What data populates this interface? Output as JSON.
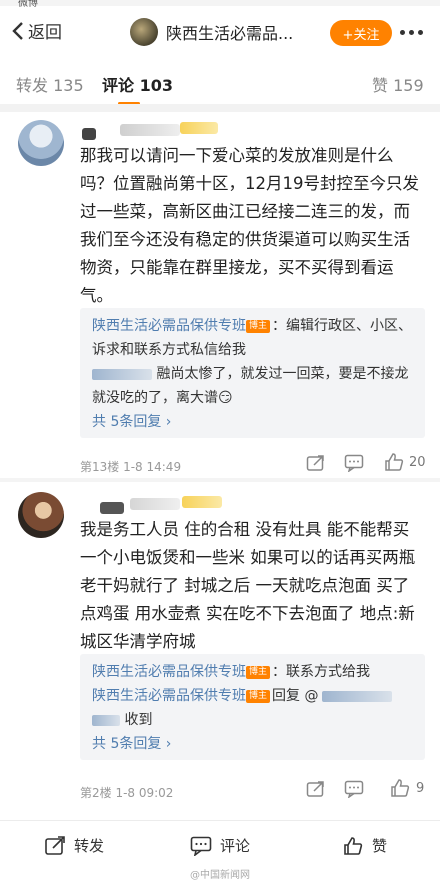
{
  "top_edge_text": "微博",
  "header": {
    "back_label": "返回",
    "title": "陕西生活必需品...",
    "follow_label": "+关注"
  },
  "tabs": [
    {
      "label": "转发 135"
    },
    {
      "label": "评论 103"
    },
    {
      "label": "赞 159"
    }
  ],
  "comments": [
    {
      "text": "那我可以请问一下爱心菜的发放准则是什么吗？位置融尚第十区，12月19号封控至今只发过一些菜，高新区曲江已经接二连三的发，而我们至今还没有稳定的供货渠道可以购买生活物资，只能靠在群里接龙，买不买得到看运气。",
      "replies": [
        {
          "author": "陕西生活必需品保供专班",
          "badge": "博主",
          "text": "：编辑行政区、小区、诉求和联系方式私信给我"
        },
        {
          "author": "",
          "text": "融尚太惨了，就发过一回菜，要是不接龙就没吃的了，离大谱"
        }
      ],
      "emoji": "😏",
      "more_replies": "共 5条回复 ›",
      "meta": "第13楼 1-8 14:49",
      "likes": "20"
    },
    {
      "text": "我是务工人员 住的合租 没有灶具 能不能帮买一个小电饭煲和一些米 如果可以的话再买两瓶老干妈就行了 封城之后 一天就吃点泡面 买了点鸡蛋 用水壶煮 实在吃不下去泡面了 地点:新城区华清学府城",
      "replies": [
        {
          "author": "陕西生活必需品保供专班",
          "badge": "博主",
          "text": "：联系方式给我"
        },
        {
          "author": "陕西生活必需品保供专班",
          "badge": "博主",
          "text": "回复 @"
        },
        {
          "author": "",
          "text": "收到"
        }
      ],
      "more_replies": "共 5条回复 ›",
      "meta": "第2楼 1-8 09:02",
      "likes": "9"
    }
  ],
  "bottom": {
    "repost": "转发",
    "comment": "评论",
    "like": "赞"
  },
  "watermark": "@中国新闻网",
  "colors": {
    "accent": "#ff8200",
    "link": "#507daf"
  }
}
